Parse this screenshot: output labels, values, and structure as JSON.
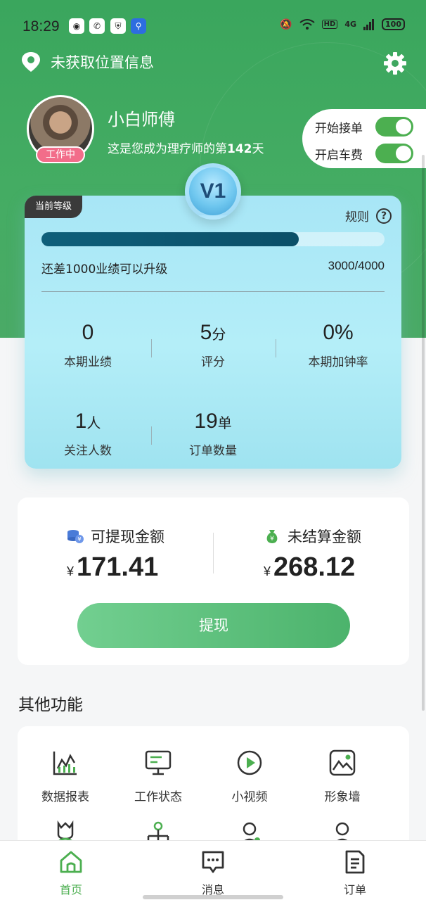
{
  "status_bar": {
    "time": "18:29",
    "network": "4G",
    "hd": "HD",
    "battery": "100"
  },
  "header": {
    "location_text": "未获取位置信息",
    "name": "小白师傅",
    "subtitle_prefix": "这是您成为理疗师的第",
    "subtitle_days": "142",
    "subtitle_suffix": "天",
    "status_badge": "工作中"
  },
  "toggles": [
    {
      "label": "开始接单",
      "on": true
    },
    {
      "label": "开启车费",
      "on": true
    }
  ],
  "level": {
    "tag": "当前等级",
    "badge": "V1",
    "rules_label": "规则",
    "progress_fraction": 0.75,
    "gap_text": "还差1000业绩可以升级",
    "progress_text": "3000/4000",
    "stats": [
      {
        "value": "0",
        "unit": "",
        "label": "本期业绩"
      },
      {
        "value": "5",
        "unit": "分",
        "label": "评分"
      },
      {
        "value": "0%",
        "unit": "",
        "label": "本期加钟率"
      },
      {
        "value": "1",
        "unit": "人",
        "label": "关注人数"
      },
      {
        "value": "19",
        "unit": "单",
        "label": "订单数量"
      }
    ]
  },
  "balance": {
    "withdrawable_label": "可提现金额",
    "withdrawable_amount": "171.41",
    "unsettled_label": "未结算金额",
    "unsettled_amount": "268.12",
    "currency": "¥",
    "withdraw_button": "提现"
  },
  "functions": {
    "title": "其他功能",
    "items": [
      {
        "label": "数据报表",
        "icon": "chart-icon"
      },
      {
        "label": "工作状态",
        "icon": "monitor-icon"
      },
      {
        "label": "小视频",
        "icon": "play-icon"
      },
      {
        "label": "形象墙",
        "icon": "image-icon"
      }
    ]
  },
  "tabs": [
    {
      "label": "首页",
      "icon": "home-icon",
      "active": true
    },
    {
      "label": "消息",
      "icon": "message-icon",
      "active": false
    },
    {
      "label": "订单",
      "icon": "order-icon",
      "active": false
    }
  ],
  "colors": {
    "brand_green": "#4caf50",
    "header_green": "#3fa760",
    "badge_pink": "#f26d8a",
    "progress_dark": "#0e5f7a"
  }
}
